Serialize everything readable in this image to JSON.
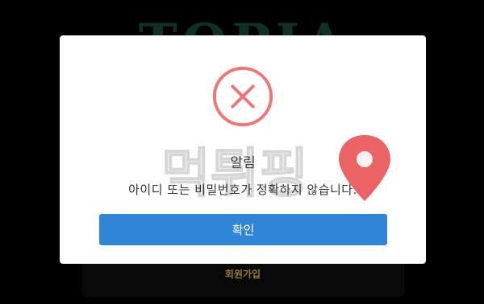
{
  "background": {
    "logo_text": "TOPIA",
    "signup_link": "회원가입"
  },
  "modal": {
    "icon": "error-x-icon",
    "title": "알림",
    "message": "아이디 또는 비밀번호가 정확하지 않습니다.",
    "confirm_label": "확인"
  },
  "watermark": {
    "text": "먹튀핑",
    "icon": "map-pin-icon"
  },
  "colors": {
    "error": "#f27474",
    "button": "#3085d6",
    "signup": "#b3932e",
    "watermark_pin": "#e8484a"
  }
}
